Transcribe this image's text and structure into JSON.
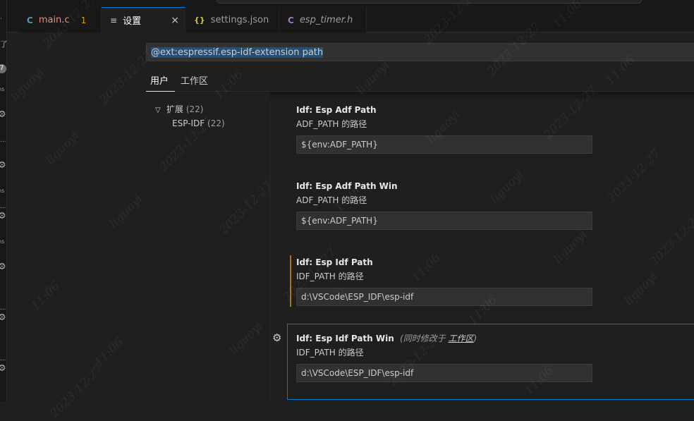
{
  "tabs": [
    {
      "icon": "C",
      "label": "main.c",
      "badge": "1"
    },
    {
      "icon": "≡",
      "label": "设置",
      "close": "×"
    },
    {
      "icon": "{}",
      "label": "settings.json"
    },
    {
      "icon": "C",
      "label": "esp_timer.h"
    }
  ],
  "search": {
    "value": "@ext:espressif.esp-idf-extension path"
  },
  "scope": {
    "user": "用户",
    "workspace": "工作区"
  },
  "toc": [
    {
      "label": "扩展",
      "count": "(22)"
    },
    {
      "label": "ESP-IDF",
      "count": "(22)"
    }
  ],
  "settings": [
    {
      "category": "Idf:",
      "name": "Esp Adf Path",
      "desc": "ADF_PATH 的路径",
      "value": "${env:ADF_PATH}"
    },
    {
      "category": "Idf:",
      "name": "Esp Adf Path Win",
      "desc": "ADF_PATH 的路径",
      "value": "${env:ADF_PATH}"
    },
    {
      "category": "Idf:",
      "name": "Esp Idf Path",
      "desc": "IDF_PATH 的路径",
      "value": "d:\\VSCode\\ESP_IDF\\esp-idf"
    },
    {
      "category": "Idf:",
      "name": "Esp Idf Path Win",
      "modified_prefix": "(同时修改于",
      "modified_link": "工作区",
      "modified_suffix": ")",
      "desc": "IDF_PATH 的路径",
      "value": "d:\\VSCode\\ESP_IDF\\esp-idf"
    }
  ],
  "activity": {
    "badge": "7",
    "glyph_a": "了",
    "glyph_ns": "ns",
    "glyph_dots": "..."
  },
  "watermark": {
    "name": "liguoyi",
    "date": "2023-12-27",
    "time": "11:06"
  },
  "colors": {
    "accent": "#0078d4",
    "modified": "#a1741f",
    "dirty": "#cca700"
  }
}
